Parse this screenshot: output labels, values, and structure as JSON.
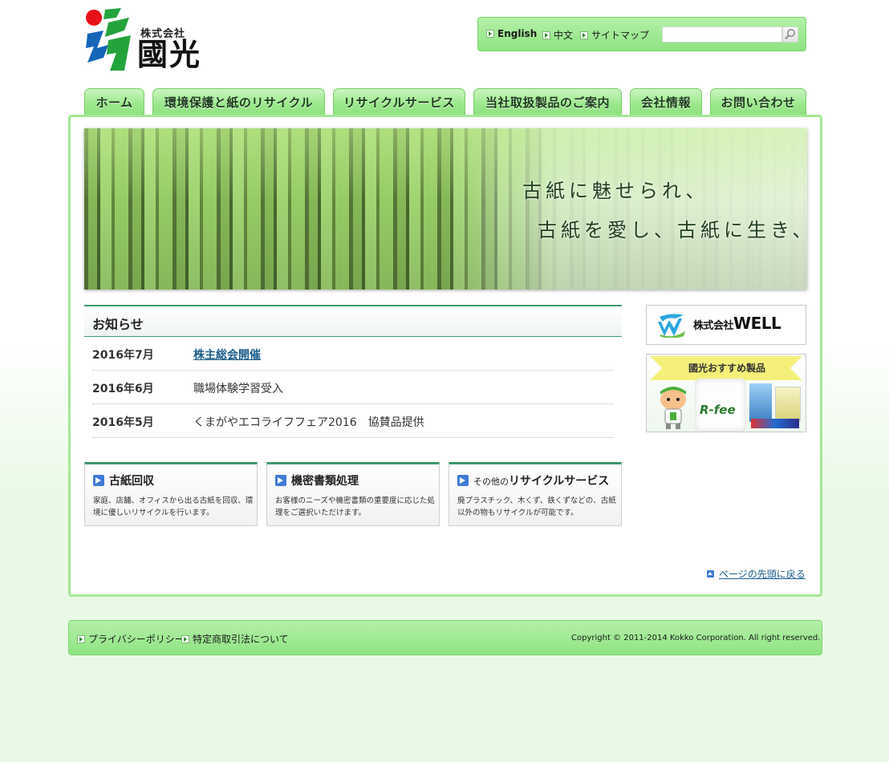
{
  "logo": {
    "company_prefix": "株式会社",
    "company_name": "國光"
  },
  "utility_nav": {
    "english": "English",
    "chinese": "中文",
    "sitemap": "サイトマップ",
    "search_placeholder": ""
  },
  "main_nav": [
    {
      "label": "ホーム"
    },
    {
      "label": "環境保護と紙のリサイクル"
    },
    {
      "label": "リサイクルサービス"
    },
    {
      "label": "当社取扱製品のご案内"
    },
    {
      "label": "会社情報"
    },
    {
      "label": "お問い合わせ"
    }
  ],
  "hero": {
    "line1": "古紙に魅せられ、",
    "line2": "古紙を愛し、古紙に生き、"
  },
  "news": {
    "title": "お知らせ",
    "items": [
      {
        "date": "2016年7月",
        "text": "株主総会開催"
      },
      {
        "date": "2016年6月",
        "text": "職場体験学習受入"
      },
      {
        "date": "2016年5月",
        "text": "くまがやエコライフフェア2016　協賛品提供"
      }
    ]
  },
  "services": [
    {
      "title_prefix": "",
      "title": "古紙回収",
      "desc": "家庭、店舗、オフィスから出る古紙を回収、環境に優しいリサイクルを行います。"
    },
    {
      "title_prefix": "",
      "title": "機密書類処理",
      "desc": "お客様のニーズや機密書類の重要度に応じた処理をご選択いただけます。"
    },
    {
      "title_prefix": "その他の",
      "title": "リサイクルサービス",
      "desc": "廃プラスチック、木くず、鉄くずなどの、古紙以外の物もリサイクルが可能です。"
    }
  ],
  "side_banners": {
    "well_corp": "株式会社",
    "well_name": "WELL",
    "products_ribbon": "國光おすすめ製品",
    "products_roll": "R-fee"
  },
  "page_top": "ページの先頭に戻る",
  "footer": {
    "privacy": "プライバシーポリシー",
    "commerce": "特定商取引法について",
    "copyright": "Copyright © 2011-2014 Kokko Corporation. All right reserved."
  },
  "colors": {
    "accent_green": "#9be88c",
    "heading_rule": "#3f9a70",
    "link_blue": "#1b5e8c",
    "icon_blue": "#3f7ad6"
  }
}
